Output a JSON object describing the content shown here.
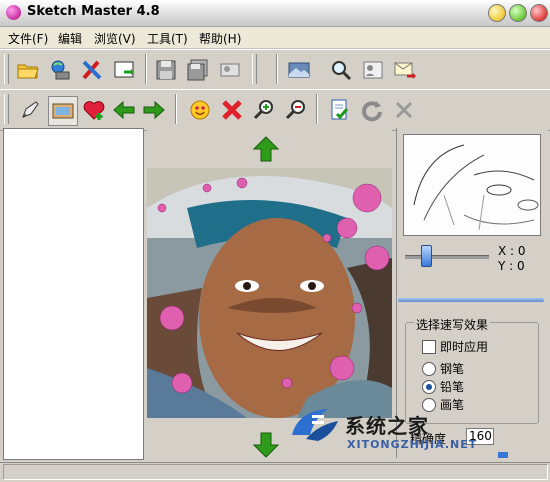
{
  "window": {
    "title": "Sketch Master 4.8"
  },
  "menu": [
    "文件(F)",
    "编辑",
    "浏览(V)",
    "工具(T)",
    "帮助(H)"
  ],
  "toolbar1": {
    "icons": [
      "open-folder-icon",
      "scanner-icon",
      "tools-icon",
      "export-icon",
      "save-icon",
      "save-all-icon",
      "print-portrait-icon",
      "image-view-icon",
      "zoom-icon",
      "contact-icon",
      "send-mail-icon"
    ]
  },
  "toolbar2": {
    "icons": [
      "pen-icon",
      "picture-icon",
      "favorite-add-icon",
      "arrow-left-icon",
      "arrow-right-icon",
      "smiley-icon",
      "delete-icon",
      "zoom-in-icon",
      "zoom-out-icon",
      "document-check-icon",
      "redo-icon",
      "close-icon"
    ]
  },
  "preview": {
    "x_label": "X : 0",
    "y_label": "Y : 0"
  },
  "effects": {
    "group_title": "选择速写效果",
    "apply_label": "即时应用",
    "options": [
      "钢笔",
      "铅笔",
      "画笔"
    ],
    "selected": "铅笔",
    "density_label": "精确度",
    "density_value": "160"
  },
  "watermark": {
    "title": "系统之家",
    "subtitle": "XITONGZHIJIA.NET"
  },
  "colors": {
    "accent": "#3a78d8",
    "arrow_green": "#2e9c1a",
    "delete_red": "#e0202a"
  }
}
